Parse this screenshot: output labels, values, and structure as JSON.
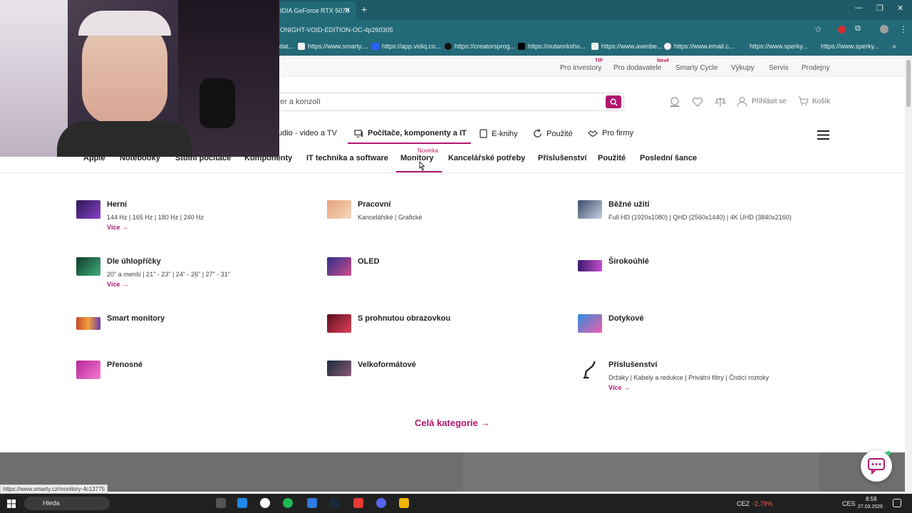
{
  "browser": {
    "tab_title": "IDIA GeForce RTX 5070",
    "address": "ONIGHT-VOID-EDITION-OC-4p260305",
    "bookmarks": [
      "dat...",
      "https://www.smarty....",
      "https://app.vidiq.co...",
      "https://creatorsprog...",
      "https://outworksho...",
      "https://www.avenbe...",
      "https://www.email.c...",
      "https://www.sperky...",
      "https://www.sperky..."
    ]
  },
  "topstrip": {
    "links": [
      "Pro investory",
      "Pro dodavatele",
      "Smarty Cycle",
      "Výkupy",
      "Servis",
      "Prodejny"
    ],
    "badge_tip": "TIP",
    "badge_new": "Nové"
  },
  "header": {
    "search_value": "er a konzolí",
    "login_label": "Přihlásit se",
    "cart_label": "Košík"
  },
  "catnav": [
    "udio - video a TV",
    "Počítače, komponenty a IT",
    "E-knihy",
    "Použité",
    "Pro firmy"
  ],
  "subnav": {
    "items": [
      "Apple",
      "Notebooky",
      "Stolní počítače",
      "Komponenty",
      "IT technika a software",
      "Monitory",
      "Kancelářské potřeby",
      "Příslušenství",
      "Použité",
      "Poslední šance"
    ],
    "new_badge": "Novinka"
  },
  "monitors": [
    {
      "title": "Herní",
      "sub": "144 Hz | 165 Hz | 180 Hz | 240 Hz",
      "more": "Více"
    },
    {
      "title": "Pracovní",
      "sub": "Kancelářské | Grafické",
      "more": ""
    },
    {
      "title": "Běžné užití",
      "sub": "Full HD (1920x1080) | QHD (2560x1440) | 4K UHD (3840x2160)",
      "more": ""
    },
    {
      "title": "Dle úhlopříčky",
      "sub": "20\" a menší | 21\" - 23\" | 24\" - 26\" | 27\" - 31\"",
      "more": "Více"
    },
    {
      "title": "OLED",
      "sub": "",
      "more": ""
    },
    {
      "title": "Širokoúhlé",
      "sub": "",
      "more": ""
    },
    {
      "title": "Smart monitory",
      "sub": "",
      "more": ""
    },
    {
      "title": "S prohnutou obrazovkou",
      "sub": "",
      "more": ""
    },
    {
      "title": "Dotykové",
      "sub": "",
      "more": ""
    },
    {
      "title": "Přenosné",
      "sub": "",
      "more": ""
    },
    {
      "title": "Velkoformátové",
      "sub": "",
      "more": ""
    },
    {
      "title": "Příslušenství",
      "sub": "Držáky | Kabely a redukce | Privátní filtry | Čisticí roztoky",
      "more": "Více"
    }
  ],
  "all_category": "Celá kategorie",
  "status_url": "https://www.smarty.cz/monitory-4c13775",
  "taskbar": {
    "search": "Hleda",
    "stock": "CEZ",
    "stock_change": "-2,79%",
    "lang": "CES",
    "time": "8:58",
    "date": "27.03.2026"
  },
  "colors": {
    "accent": "#b0176f",
    "chrome": "#236a78"
  }
}
